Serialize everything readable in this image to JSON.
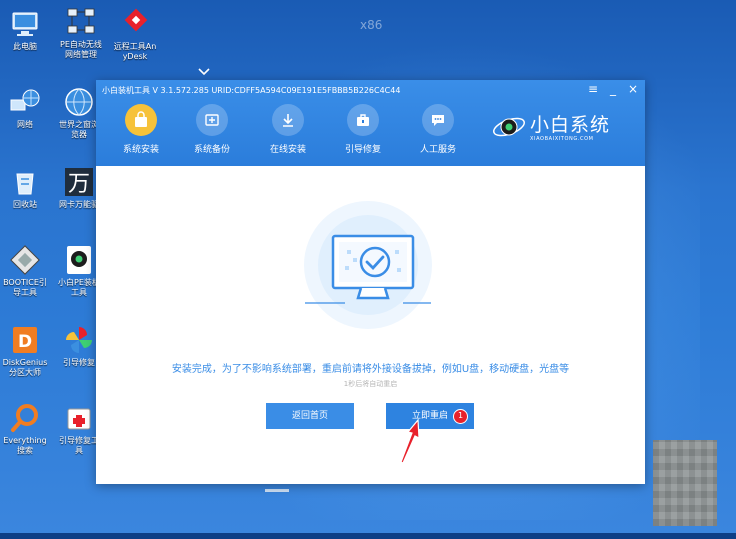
{
  "desktop": {
    "watermark": "x86",
    "icons": [
      {
        "id": "this-pc",
        "label": "此电脑"
      },
      {
        "id": "pe-network",
        "label": "PE自动无线网络管理"
      },
      {
        "id": "anydesk",
        "label": "远程工具AnyDesk"
      },
      {
        "id": "network",
        "label": "网络"
      },
      {
        "id": "browser",
        "label": "世界之窗浏览器"
      },
      {
        "id": "recycle-bin",
        "label": "回收站"
      },
      {
        "id": "wan-shortcut",
        "label": "网卡万能驱"
      },
      {
        "id": "bootice",
        "label": "BOOTICE引导工具"
      },
      {
        "id": "xiaobai-pe",
        "label": "小白PE装机工具"
      },
      {
        "id": "diskgenius",
        "label": "DiskGenius分区大师"
      },
      {
        "id": "boot-repair-1",
        "label": "引导修复"
      },
      {
        "id": "everything",
        "label": "Everything搜索"
      },
      {
        "id": "boot-repair-2",
        "label": "引导修复工具"
      }
    ]
  },
  "window": {
    "title": "小白装机工具 V 3.1.572.285 URID:CDFF5A594C09E191E5FBBB5B226C4C44",
    "controls": {
      "menu": "≡",
      "minimize": "_",
      "close": "×"
    },
    "tabs": [
      {
        "label": "系统安装",
        "icon": "bag-icon",
        "active": true
      },
      {
        "label": "系统备份",
        "icon": "backup-icon",
        "active": false
      },
      {
        "label": "在线安装",
        "icon": "download-icon",
        "active": false
      },
      {
        "label": "引导修复",
        "icon": "toolbox-icon",
        "active": false
      },
      {
        "label": "人工服务",
        "icon": "chat-icon",
        "active": false
      }
    ],
    "brand": {
      "name": "小白系统",
      "subtitle": "XIAOBAIXITONG.COM"
    },
    "message": "安装完成，为了不影响系统部署，重启前请将外接设备拔掉，例如U盘，移动硬盘，光盘等",
    "countdown": "1秒后将自动重启",
    "buttons": {
      "home": "返回首页",
      "restart": "立即重启"
    },
    "badge": "1"
  },
  "colors": {
    "accent": "#3a8de6",
    "header": "#2b7ddb",
    "active_tab": "#f6c23a",
    "badge": "#e8212b"
  }
}
